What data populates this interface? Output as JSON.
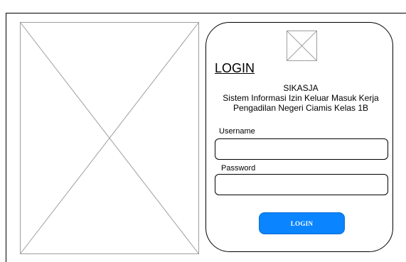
{
  "login": {
    "heading": "LOGIN",
    "app_name": "SIKASJA",
    "app_description_line1": "Sistem Informasi Izin Keluar Masuk Kerja",
    "app_description_line2": "Pengadilan Negeri Ciamis Kelas 1B",
    "username_label": "Username",
    "username_value": "",
    "password_label": "Password",
    "password_value": "",
    "button_label": "LOGIN"
  },
  "colors": {
    "button_background": "#0a84ff",
    "button_text": "#ffffff",
    "placeholder_stroke": "#9e9e9e"
  },
  "icons": {
    "hero": "image-placeholder-icon",
    "logo": "logo-placeholder-icon"
  }
}
